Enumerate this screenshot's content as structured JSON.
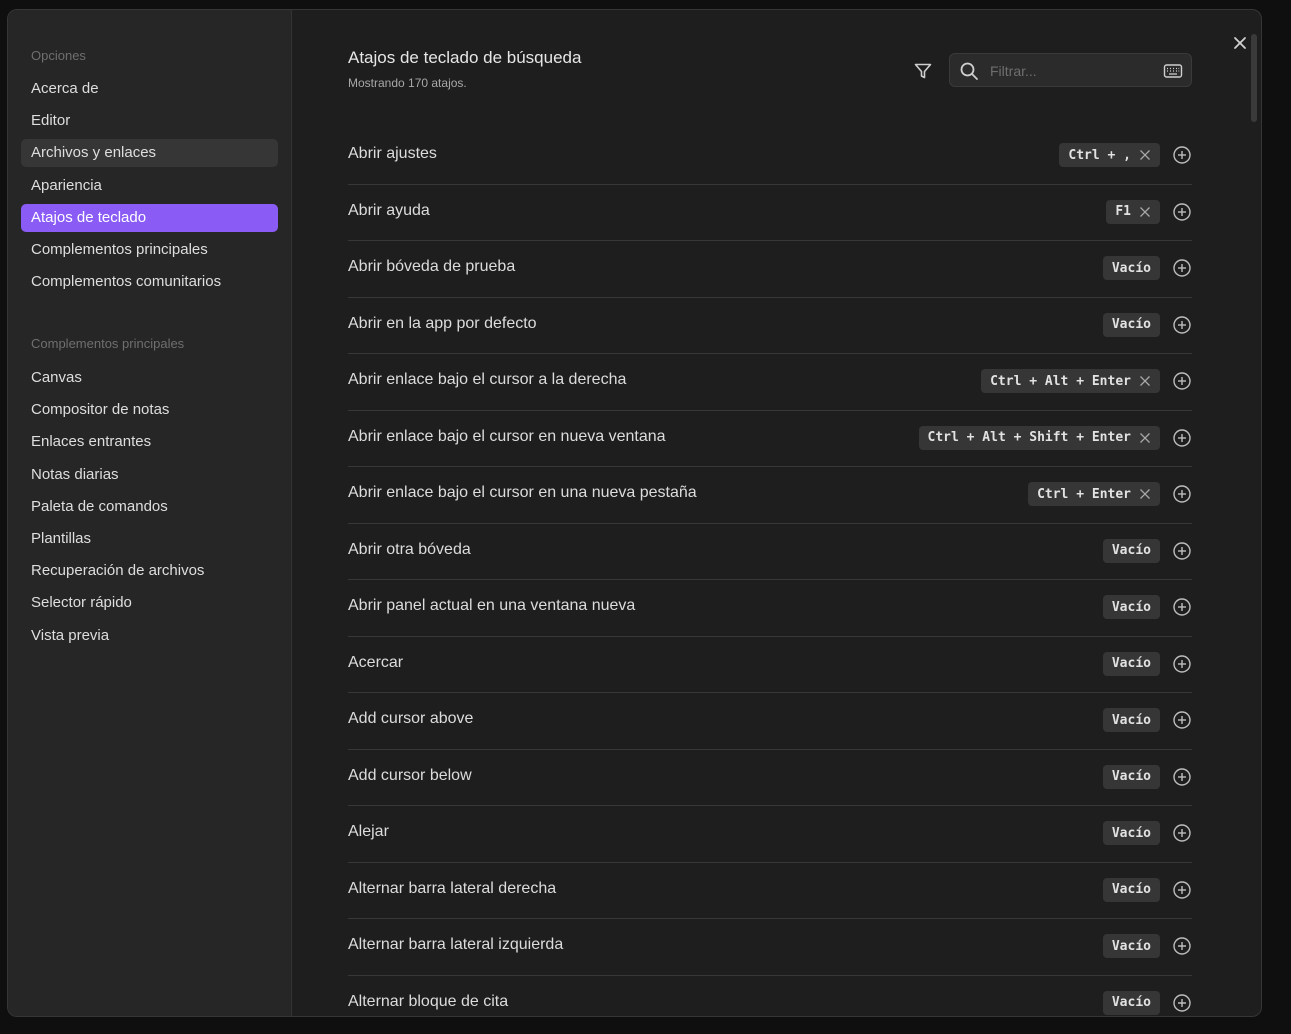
{
  "sidebar": {
    "group1_title": "Opciones",
    "group1": [
      "Acerca de",
      "Editor",
      "Archivos y enlaces",
      "Apariencia",
      "Atajos de teclado",
      "Complementos principales",
      "Complementos comunitarios"
    ],
    "group2_title": "Complementos principales",
    "group2": [
      "Canvas",
      "Compositor de notas",
      "Enlaces entrantes",
      "Notas diarias",
      "Paleta de comandos",
      "Plantillas",
      "Recuperación de archivos",
      "Selector rápido",
      "Vista previa"
    ],
    "active_item": "Atajos de teclado",
    "hover_item": "Archivos y enlaces"
  },
  "header": {
    "title": "Atajos de teclado de búsqueda",
    "subtitle": "Mostrando 170 atajos."
  },
  "search": {
    "placeholder": "Filtrar..."
  },
  "colors": {
    "accent": "#8a5cf5",
    "background": "#1e1e1e",
    "sidebar": "#262626"
  },
  "hotkeys": [
    {
      "name": "Abrir ajustes",
      "key": "Ctrl + ,",
      "removable": true
    },
    {
      "name": "Abrir ayuda",
      "key": "F1",
      "removable": true
    },
    {
      "name": "Abrir bóveda de prueba",
      "key": "Vacío",
      "removable": false
    },
    {
      "name": "Abrir en la app por defecto",
      "key": "Vacío",
      "removable": false
    },
    {
      "name": "Abrir enlace bajo el cursor a la derecha",
      "key": "Ctrl + Alt + Enter",
      "removable": true
    },
    {
      "name": "Abrir enlace bajo el cursor en nueva ventana",
      "key": "Ctrl + Alt + Shift + Enter",
      "removable": true
    },
    {
      "name": "Abrir enlace bajo el cursor en una nueva pestaña",
      "key": "Ctrl + Enter",
      "removable": true
    },
    {
      "name": "Abrir otra bóveda",
      "key": "Vacío",
      "removable": false
    },
    {
      "name": "Abrir panel actual en una ventana nueva",
      "key": "Vacío",
      "removable": false
    },
    {
      "name": "Acercar",
      "key": "Vacío",
      "removable": false
    },
    {
      "name": "Add cursor above",
      "key": "Vacío",
      "removable": false
    },
    {
      "name": "Add cursor below",
      "key": "Vacío",
      "removable": false
    },
    {
      "name": "Alejar",
      "key": "Vacío",
      "removable": false
    },
    {
      "name": "Alternar barra lateral derecha",
      "key": "Vacío",
      "removable": false
    },
    {
      "name": "Alternar barra lateral izquierda",
      "key": "Vacío",
      "removable": false
    },
    {
      "name": "Alternar bloque de cita",
      "key": "Vacío",
      "removable": false
    }
  ]
}
